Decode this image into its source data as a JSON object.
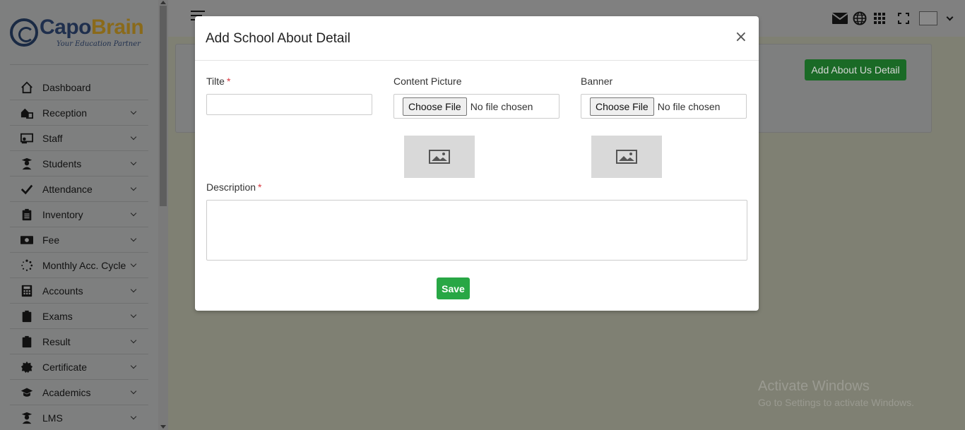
{
  "brand": {
    "part1": "Capo",
    "part2": "Brain",
    "tagline": "Your Education Partner"
  },
  "sidebar": {
    "items": [
      {
        "label": "Dashboard",
        "icon": "home-icon",
        "has_submenu": false
      },
      {
        "label": "Reception",
        "icon": "reception-icon",
        "has_submenu": true
      },
      {
        "label": "Staff",
        "icon": "staff-icon",
        "has_submenu": true
      },
      {
        "label": "Students",
        "icon": "students-icon",
        "has_submenu": true
      },
      {
        "label": "Attendance",
        "icon": "check-icon",
        "has_submenu": true
      },
      {
        "label": "Inventory",
        "icon": "clipboard-list-icon",
        "has_submenu": true
      },
      {
        "label": "Fee",
        "icon": "money-icon",
        "has_submenu": true
      },
      {
        "label": "Monthly Acc. Cycle",
        "icon": "spinner-icon",
        "has_submenu": true
      },
      {
        "label": "Accounts",
        "icon": "calculator-icon",
        "has_submenu": true
      },
      {
        "label": "Exams",
        "icon": "clipboard-icon",
        "has_submenu": true
      },
      {
        "label": "Result",
        "icon": "clipboard-icon",
        "has_submenu": true
      },
      {
        "label": "Certificate",
        "icon": "certificate-icon",
        "has_submenu": true
      },
      {
        "label": "Academics",
        "icon": "graduation-cap-icon",
        "has_submenu": true
      },
      {
        "label": "LMS",
        "icon": "teacher-icon",
        "has_submenu": true
      }
    ]
  },
  "header": {
    "icons": [
      "envelope-icon",
      "globe-icon",
      "apps-grid-icon",
      "fullscreen-icon"
    ]
  },
  "page": {
    "add_button_label": "Add About Us Detail"
  },
  "modal": {
    "title": "Add School About Detail",
    "close_glyph": "×",
    "title_label": "Tilte",
    "title_value": "",
    "required_mark": "*",
    "content_picture_label": "Content Picture",
    "banner_label": "Banner",
    "choose_file_label": "Choose File",
    "no_file_text": "No file chosen",
    "description_label": "Description",
    "description_value": "",
    "save_label": "Save"
  },
  "watermark": {
    "line1": "Activate Windows",
    "line2": "Go to Settings to activate Windows."
  }
}
